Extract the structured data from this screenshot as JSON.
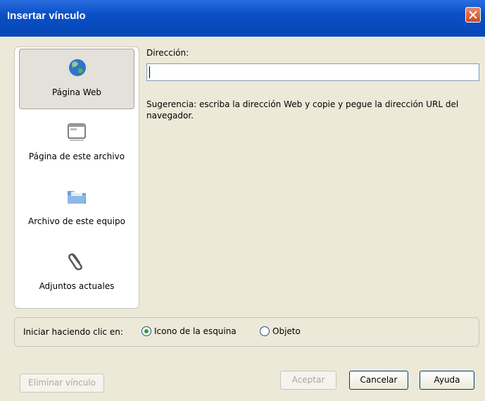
{
  "window": {
    "title": "Insertar vínculo"
  },
  "left_panel": {
    "items": [
      {
        "label": "Página Web",
        "icon": "globe-icon",
        "selected": true
      },
      {
        "label": "Página de este archivo",
        "icon": "window-icon",
        "selected": false
      },
      {
        "label": "Archivo de este equipo",
        "icon": "folder-icon",
        "selected": false
      },
      {
        "label": "Adjuntos actuales",
        "icon": "paperclip-icon",
        "selected": false
      }
    ]
  },
  "address": {
    "label": "Dirección:",
    "value": "",
    "placeholder": ""
  },
  "hint": "Sugerencia: escriba la dirección Web y copie y pegue la dirección URL del navegador.",
  "start": {
    "label": "Iniciar haciendo clic en:",
    "options": [
      {
        "label": "Icono de la esquina",
        "selected": true
      },
      {
        "label": "Objeto",
        "selected": false
      }
    ]
  },
  "buttons": {
    "remove": "Eliminar vínculo",
    "accept": "Aceptar",
    "cancel": "Cancelar",
    "help": "Ayuda"
  },
  "colors": {
    "titlebar": "#0a4fc6",
    "dialog_bg": "#ece9d8",
    "close": "#d2451f"
  }
}
